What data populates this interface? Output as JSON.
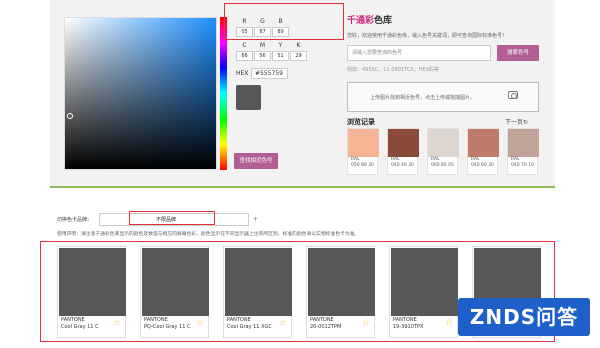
{
  "picker": {
    "rgb": [
      {
        "label": "R",
        "value": "05"
      },
      {
        "label": "G",
        "value": "87"
      },
      {
        "label": "B",
        "value": "89"
      }
    ],
    "cmyk": [
      {
        "label": "C",
        "value": "66"
      },
      {
        "label": "M",
        "value": "56"
      },
      {
        "label": "Y",
        "value": "51"
      },
      {
        "label": "K",
        "value": "29"
      }
    ],
    "hex_label": "HEX",
    "hex_value": "#555759",
    "preview_color": "#555759",
    "find_button": "查找相近色号"
  },
  "brand": {
    "title_main": "千通彩",
    "title_sub": "色库",
    "description": "您好，欢迎使用千通彩色库，输入色号关键词，即可查询国际标准色号！",
    "search_placeholder": "请输入您要查询的色号",
    "search_button": "搜索色号",
    "example": "例如：4955C，11-0601TCX，HEX码等",
    "upload_text": "上传图片找到相近色号，点击上传或拖拽图片。"
  },
  "history": {
    "title": "浏览记录",
    "next_label": "下一页",
    "items": [
      {
        "color": "#f5b594",
        "brand": "RAL",
        "code": "050 80 30"
      },
      {
        "color": "#8a4a3a",
        "brand": "RAL",
        "code": "040 40 30"
      },
      {
        "color": "#ddd5cf",
        "brand": "RAL",
        "code": "060 85 05"
      },
      {
        "color": "#c07a6a",
        "brand": "RAL",
        "code": "040 60 30"
      },
      {
        "color": "#c0a49a",
        "brand": "RAL",
        "code": "040 70 10"
      }
    ]
  },
  "filter": {
    "label": "切换色卡品牌：",
    "selected": "不限品牌",
    "plus": "+",
    "notice": "使用声明：请注意千通彩色库显示的颜色及数值与相应的屏幕色彩，颜色显示在不同显示器上也有所区别，标准的颜色请以实物标准色卡为准。"
  },
  "results": [
    {
      "brand": "PANTONE",
      "name": "Cool Gray 11 C"
    },
    {
      "brand": "PANTONE",
      "name": "PQ-Cool Gray 11 C"
    },
    {
      "brand": "PANTONE",
      "name": "Cool Gray 11 XGC"
    },
    {
      "brand": "PANTONE",
      "name": "20-0012TPM"
    },
    {
      "brand": "PANTONE",
      "name": "19-3910TPX"
    },
    {
      "brand": "PANTONE",
      "name": ""
    }
  ],
  "watermark": "ZNDS问答"
}
